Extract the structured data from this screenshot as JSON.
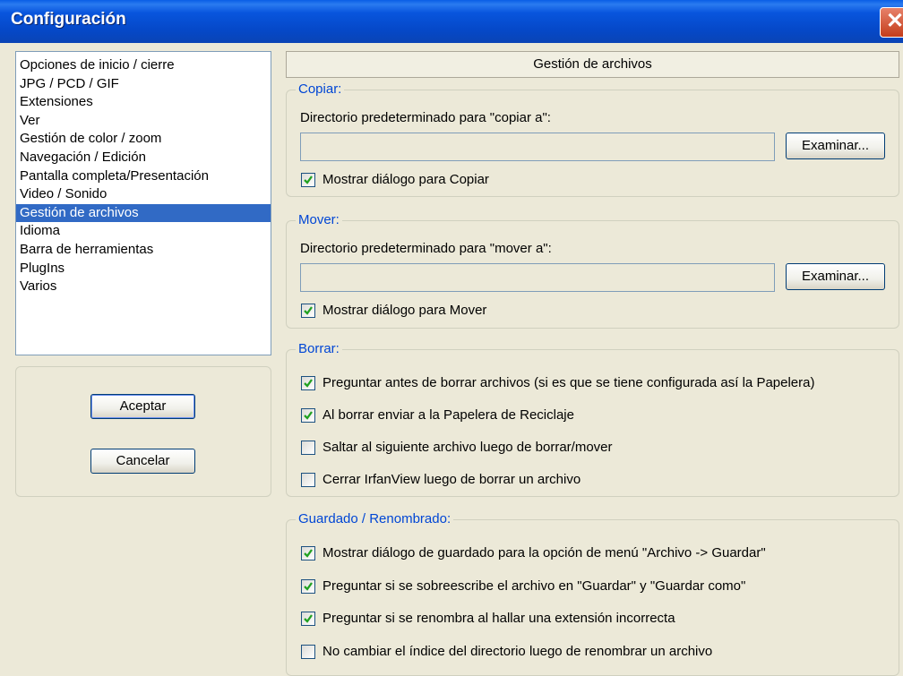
{
  "window": {
    "title": "Configuración",
    "close_glyph": "✕"
  },
  "categories": [
    {
      "label": "Opciones de inicio / cierre",
      "selected": false
    },
    {
      "label": "JPG / PCD / GIF",
      "selected": false
    },
    {
      "label": "Extensiones",
      "selected": false
    },
    {
      "label": "Ver",
      "selected": false
    },
    {
      "label": "Gestión de color / zoom",
      "selected": false
    },
    {
      "label": "Navegación / Edición",
      "selected": false
    },
    {
      "label": "Pantalla completa/Presentación",
      "selected": false
    },
    {
      "label": "Video / Sonido",
      "selected": false
    },
    {
      "label": "Gestión de archivos",
      "selected": true
    },
    {
      "label": "Idioma",
      "selected": false
    },
    {
      "label": "Barra de herramientas",
      "selected": false
    },
    {
      "label": "PlugIns",
      "selected": false
    },
    {
      "label": "Varios",
      "selected": false
    }
  ],
  "buttons": {
    "accept": "Aceptar",
    "cancel": "Cancelar"
  },
  "section_title": "Gestión de archivos",
  "copy": {
    "legend": "Copiar:",
    "dir_label": "Directorio predeterminado para \"copiar a\":",
    "dir_value": "",
    "browse": "Examinar...",
    "show_dialog": {
      "label": "Mostrar diálogo para Copiar",
      "checked": true
    }
  },
  "move": {
    "legend": "Mover:",
    "dir_label": "Directorio predeterminado para \"mover a\":",
    "dir_value": "",
    "browse": "Examinar...",
    "show_dialog": {
      "label": "Mostrar diálogo para Mover",
      "checked": true
    }
  },
  "delete": {
    "legend": "Borrar:",
    "options": [
      {
        "label": "Preguntar antes de borrar archivos (si es que se tiene configurada así la Papelera)",
        "checked": true
      },
      {
        "label": "Al borrar enviar a la Papelera de Reciclaje",
        "checked": true
      },
      {
        "label": "Saltar al siguiente archivo luego de borrar/mover",
        "checked": false
      },
      {
        "label": "Cerrar IrfanView luego de borrar un archivo",
        "checked": false
      }
    ]
  },
  "save": {
    "legend": "Guardado / Renombrado:",
    "options": [
      {
        "label": "Mostrar diálogo de guardado para la opción de menú \"Archivo -> Guardar\"",
        "checked": true
      },
      {
        "label": "Preguntar si se sobreescribe el archivo en \"Guardar\" y \"Guardar como\"",
        "checked": true
      },
      {
        "label": "Preguntar si se renombra al hallar una extensión incorrecta",
        "checked": true
      },
      {
        "label": "No cambiar el índice del directorio luego de renombrar un archivo",
        "checked": false
      }
    ]
  },
  "colors": {
    "title_bar": "#0855dd",
    "selection": "#316ac5",
    "group_label": "#0046d5",
    "check": "#21a121"
  }
}
